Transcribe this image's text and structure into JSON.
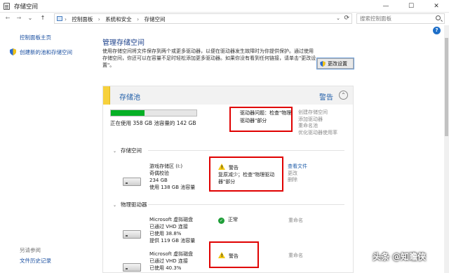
{
  "window": {
    "title": "存储空间",
    "minimize": "—",
    "maximize": "☐",
    "close": "✕"
  },
  "nav": {
    "back": "←",
    "forward": "→",
    "recent": "⌄",
    "up": "↑",
    "breadcrumbs": [
      "控制面板",
      "系统和安全",
      "存储空间"
    ],
    "separator": "›",
    "dropdown": "⌄",
    "refresh": "⟳",
    "search_placeholder": "搜索控制面板"
  },
  "help_glyph": "?",
  "sidebar": {
    "home_link": "控制面板主页",
    "create_link": "创建新的池和存储空间",
    "see_also": "另请参阅",
    "file_history": "文件历史记录"
  },
  "main": {
    "title": "管理存储空间",
    "description": "使用存储空间将文件保存到两个或更多驱动器，以便在驱动器发生故障时为你提供保护。通过使用存储空间，你还可以在容量不足时轻松添加更多驱动器。如果你没有看到任何链接，请单击\"更改设置\"。",
    "change_settings": "更改设置"
  },
  "pool": {
    "title": "存储池",
    "warning": "警告",
    "collapse_glyph": "⌃",
    "usage_fraction": 0.39,
    "usage_text": "正在使用 358 GB 池容量的 142 GB",
    "alert_text": "驱动器问题：检查\"物理驱动器\"部分",
    "actions": [
      "创建存储空间",
      "添加驱动器",
      "重命名池",
      "优化驱动器使用率"
    ]
  },
  "spaces_section": {
    "label": "存储空间",
    "chevron": "⌄",
    "item": {
      "lines": [
        "游戏存储区 (I:)",
        "奇偶校验",
        "234 GB",
        "使用 138 GB 池容量"
      ],
      "status_title": "警告",
      "status_detail": "复原减少；检查\"物理驱动器\"部分",
      "actions": [
        "查看文件",
        "更改",
        "删除"
      ]
    }
  },
  "physical_section": {
    "label": "物理驱动器",
    "chevron": "⌄",
    "drives": [
      {
        "lines": [
          "Microsoft 虚拟磁盘",
          "已通过 VHD 连接",
          "已使用 38.8%",
          "提供 119 GB 池容量"
        ],
        "status": "正常",
        "status_glyph": "✓",
        "action": "重命名"
      },
      {
        "lines": [
          "Microsoft 虚拟磁盘",
          "已通过 VHD 连接",
          "已使用 40.3%"
        ],
        "status": "警告",
        "action": "重命名"
      }
    ]
  },
  "watermark": "头条 @知瞻侠"
}
